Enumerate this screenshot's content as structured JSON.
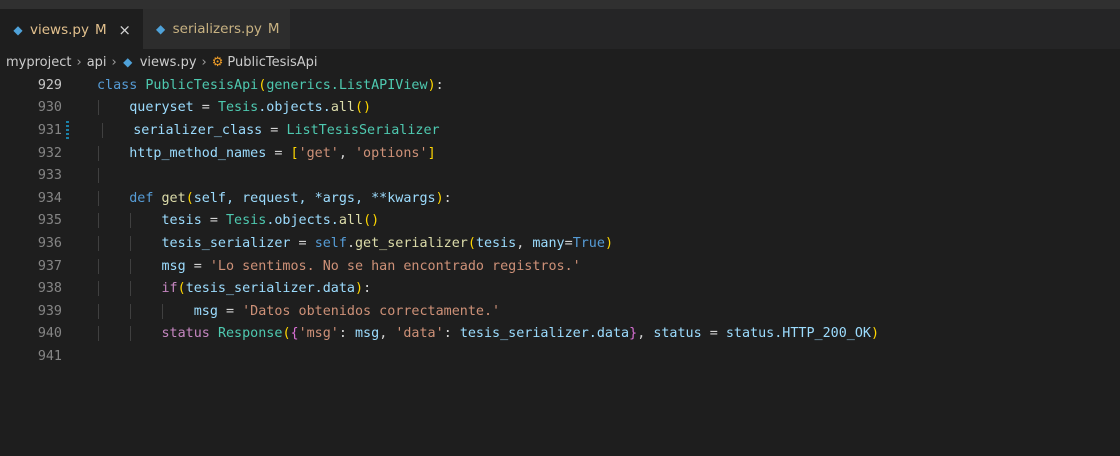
{
  "tabs": [
    {
      "label": "views.py",
      "status": "M",
      "close": "×",
      "active": true
    },
    {
      "label": "serializers.py",
      "status": "M",
      "active": false
    }
  ],
  "breadcrumb": {
    "items": [
      "myproject",
      "api",
      "views.py",
      "PublicTesisApi"
    ],
    "separator": "›"
  },
  "editor": {
    "current_line": "929",
    "modified_line": "931",
    "line_numbers": [
      "929",
      "930",
      "931",
      "932",
      "933",
      "934",
      "935",
      "936",
      "937",
      "938",
      "939",
      "940",
      "941"
    ],
    "lines": {
      "l929": {
        "kw": "class",
        "name": "PublicTesisApi",
        "p1": "(",
        "base": "generics.ListAPIView",
        "p2": ")",
        "colon": ":"
      },
      "l930": {
        "var": "queryset",
        "eq": " = ",
        "cls": "Tesis",
        "rest": ".objects.",
        "fn": "all",
        "paren": "()"
      },
      "l931": {
        "var": "serializer_class",
        "eq": " = ",
        "cls": "ListTesisSerializer"
      },
      "l932": {
        "var": "http_method_names",
        "eq": " = ",
        "open": "[",
        "s1": "'get'",
        "comma": ", ",
        "s2": "'options'",
        "close": "]"
      },
      "l934": {
        "kw": "def",
        "fn": "get",
        "p1": "(",
        "args": "self, request, *args, **kwargs",
        "p2": ")",
        "colon": ":"
      },
      "l935": {
        "var": "tesis",
        "eq": " = ",
        "cls": "Tesis",
        "rest": ".objects.",
        "fn": "all",
        "paren": "()"
      },
      "l936": {
        "var": "tesis_serializer",
        "eq": " = ",
        "self": "self",
        "dot": ".",
        "fn": "get_serializer",
        "p1": "(",
        "a1": "tesis",
        "comma": ", ",
        "a2": "many",
        "eq2": "=",
        "true": "True",
        "p2": ")"
      },
      "l937": {
        "var": "msg",
        "eq": " = ",
        "str": "'Lo sentimos. No se han encontrado registros.'"
      },
      "l938": {
        "kw": "if",
        "p1": "(",
        "arg": "tesis_serializer.data",
        "p2": ")",
        "colon": ":"
      },
      "l939": {
        "var": "msg",
        "eq": " = ",
        "str": "'Datos obtenidos correctamente.'"
      },
      "l940": {
        "kw": "status",
        "cls": "Response",
        "p1": "(",
        "b1": "{",
        "k1": "'msg'",
        "c1": ": ",
        "v1": "msg",
        "cm": ", ",
        "k2": "'data'",
        "c2": ": ",
        "v2": "tesis_serializer.data",
        "b2": "}",
        "cm2": ", ",
        "eq": " = ",
        "v3": "status.HTTP_200_OK",
        "p2": ")"
      }
    }
  },
  "colors": {
    "background": "#1e1e1e",
    "keyword": "#569cd6",
    "control": "#c586c0",
    "class": "#4ec9b0",
    "variable": "#9cdcfe",
    "function": "#dcdcaa",
    "string": "#ce9178",
    "modified_tab": "#e2c08d"
  },
  "icons": {
    "python": "python-file-icon",
    "class_symbol": "class-symbol-icon",
    "close": "close-icon"
  }
}
